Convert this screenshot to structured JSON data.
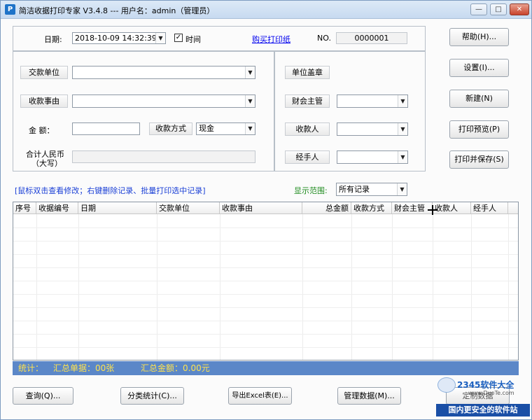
{
  "window": {
    "title": "简洁收据打印专家 V3.4.8 --- 用户名：admin（管理员）",
    "app_icon_glyph": "P",
    "controls": [
      "—",
      "□",
      "✕"
    ]
  },
  "header": {
    "date_label": "日期:",
    "date_value": "2018-10-09 14:32:39",
    "time_checkbox_label": "时间",
    "buy_link": "购买打印纸",
    "no_label": "NO.",
    "no_value": "0000001"
  },
  "form": {
    "payer_button": "交款单位",
    "reason_button": "收款事由",
    "amount_label": "金    额：",
    "payment_method_button": "收款方式",
    "payment_method_value": "现金",
    "total_rmb_label_line1": "合计人民币",
    "total_rmb_label_line2": "（大写）",
    "stamp_button": "单位盖章",
    "accountant_button": "财会主管",
    "payee_button": "收款人",
    "handler_button": "经手人"
  },
  "side_buttons": {
    "help": "帮助(H)...",
    "settings": "设置(I)...",
    "new": "新建(N)",
    "preview": "打印预览(P)",
    "print_save": "打印并保存(S)"
  },
  "hint": "[鼠标双击查看修改；右键删除记录、批量打印选中记录]",
  "range": {
    "label": "显示范围:",
    "value": "所有记录"
  },
  "table": {
    "columns": [
      "序号",
      "收据编号",
      "日期",
      "交款单位",
      "收款事由",
      "总金额",
      "收款方式",
      "财会主管",
      "收款人",
      "经手人"
    ],
    "rows": []
  },
  "status": {
    "label": "统计：",
    "count_text": "汇总单据：00张",
    "amount_text": "汇总金额：0.00元"
  },
  "bottom_buttons": {
    "query": "查询(Q)...",
    "category_stats": "分类统计(C)...",
    "export_excel": "导出Excel表(E)...",
    "manage_data": "管理数据(M)...",
    "custom_data": "定制数据"
  },
  "watermark": {
    "brand": "2345软件大全",
    "url": "www.DuoTe.com",
    "slogan": "国内更安全的软件站"
  },
  "colors": {
    "status_bg": "#5b87c8",
    "status_text": "#ffe24d",
    "hint_text": "#1a3fd6",
    "range_label": "#1c8a1c",
    "link": "#0000ee"
  }
}
